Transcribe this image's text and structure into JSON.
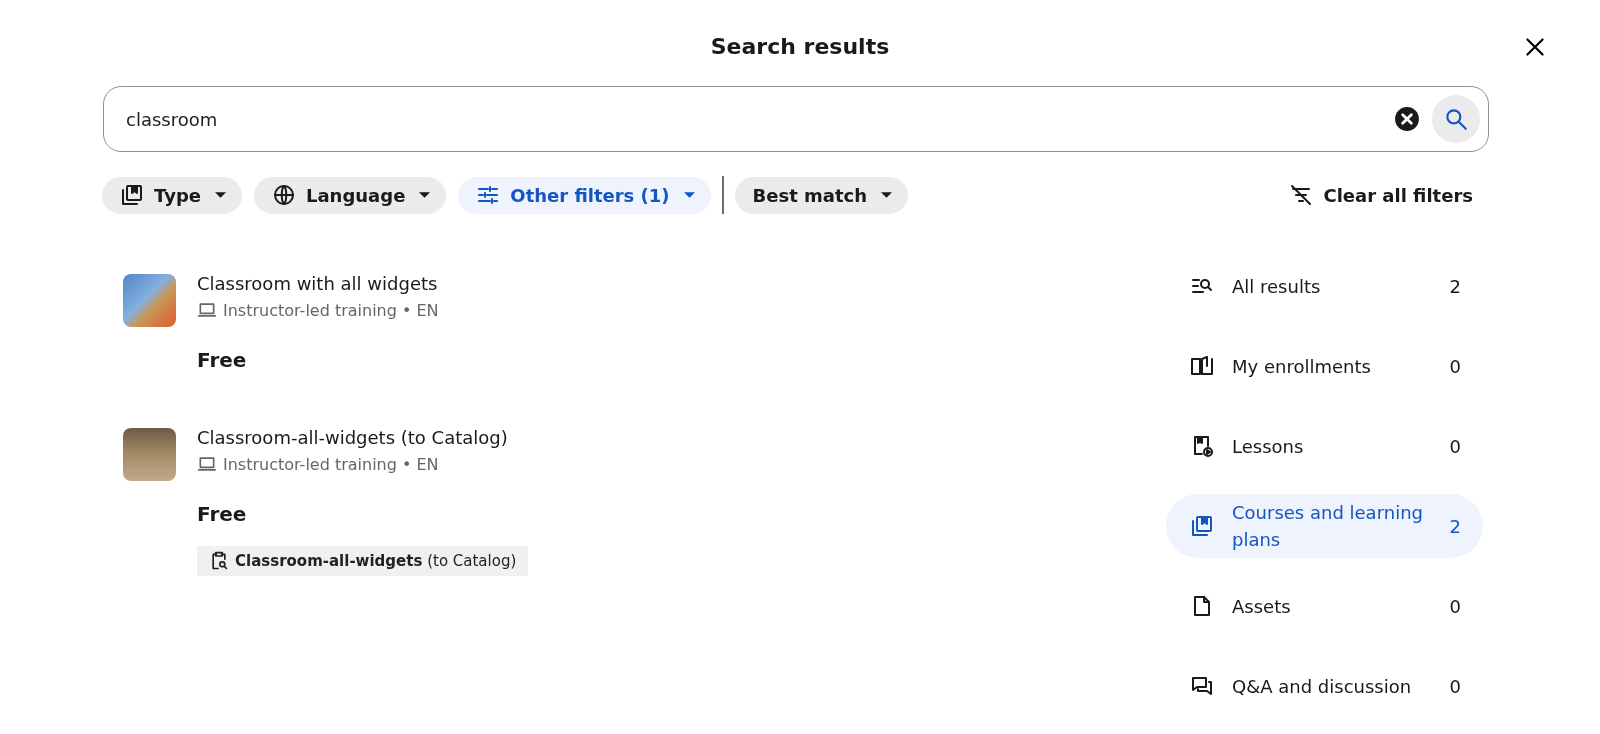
{
  "title": "Search results",
  "search": {
    "value": "classroom"
  },
  "filters": [
    {
      "kind": "type",
      "label": "Type",
      "active": false
    },
    {
      "kind": "language",
      "label": "Language",
      "active": false
    },
    {
      "kind": "other",
      "label": "Other filters (1)",
      "active": true
    },
    {
      "kind": "sort",
      "label": "Best match",
      "active": false
    }
  ],
  "clear_filters": "Clear all filters",
  "results": [
    {
      "title": "Classroom with all widgets",
      "meta": "Instructor-led training • EN",
      "price": "Free"
    },
    {
      "title": "Classroom-all-widgets (to Catalog)",
      "meta": "Instructor-led training • EN",
      "price": "Free",
      "tag": "**Classroom-all-widgets** (to Catalog)"
    }
  ],
  "categories": [
    {
      "kind": "all",
      "label": "All results",
      "count": "2",
      "selected": false
    },
    {
      "kind": "enrollments",
      "label": "My enrollments",
      "count": "0",
      "selected": false
    },
    {
      "kind": "lessons",
      "label": "Lessons",
      "count": "0",
      "selected": false
    },
    {
      "kind": "courses",
      "label": "Courses and learning plans",
      "count": "2",
      "selected": true
    },
    {
      "kind": "assets",
      "label": "Assets",
      "count": "0",
      "selected": false
    },
    {
      "kind": "qa",
      "label": "Q&A and discussion",
      "count": "0",
      "selected": false
    }
  ]
}
